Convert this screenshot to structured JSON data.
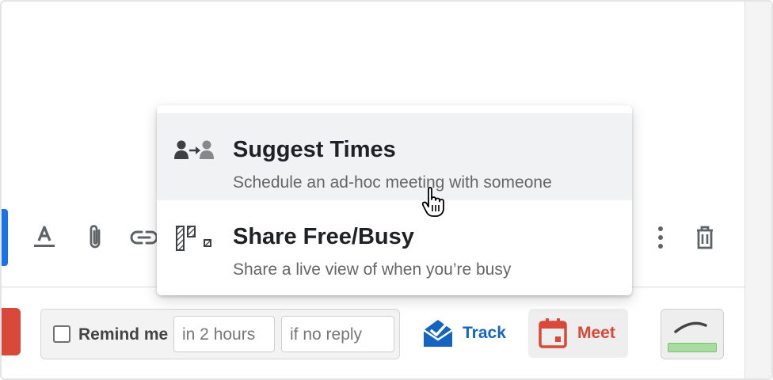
{
  "popup_menu": {
    "items": [
      {
        "title": "Suggest Times",
        "subtitle": "Schedule an ad-hoc meeting with someone",
        "icon": "person-arrow-person-icon"
      },
      {
        "title": "Share Free/Busy",
        "subtitle": "Share a live view of when you’re busy",
        "icon": "free-busy-blocks-icon"
      }
    ]
  },
  "toolbar": {
    "icons": [
      "text-format-icon",
      "attachment-icon",
      "link-icon",
      "more-vert-icon",
      "trash-icon"
    ]
  },
  "bottom_bar": {
    "remind": {
      "label": "Remind me",
      "checked": false,
      "time_placeholder": "in 2 hours",
      "condition_placeholder": "if no reply"
    },
    "track_label": "Track",
    "meet_label": "Meet"
  },
  "colors": {
    "accent_blue": "#1a73e8",
    "send_red": "#d9493a",
    "track_blue": "#1565c0",
    "meet_red": "#d9493a",
    "signature_green": "#a8dca0"
  }
}
